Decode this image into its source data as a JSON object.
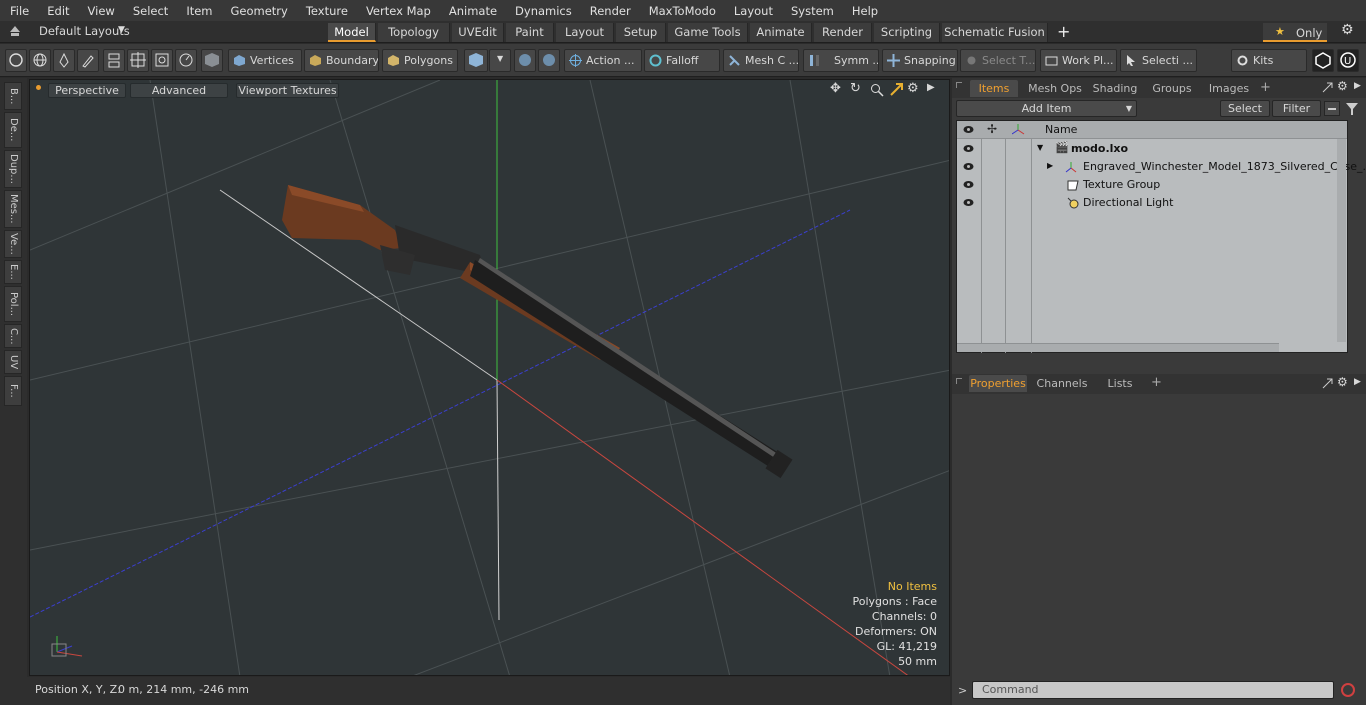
{
  "menu": [
    "File",
    "Edit",
    "View",
    "Select",
    "Item",
    "Geometry",
    "Texture",
    "Vertex Map",
    "Animate",
    "Dynamics",
    "Render",
    "MaxToModo",
    "Layout",
    "System",
    "Help"
  ],
  "layout_selector": "Default Layouts",
  "layout_tabs": [
    {
      "label": "Model",
      "active": true
    },
    {
      "label": "Topology"
    },
    {
      "label": "UVEdit"
    },
    {
      "label": "Paint"
    },
    {
      "label": "Layout"
    },
    {
      "label": "Setup"
    },
    {
      "label": "Game Tools"
    },
    {
      "label": "Animate"
    },
    {
      "label": "Render"
    },
    {
      "label": "Scripting"
    },
    {
      "label": "Schematic Fusion"
    }
  ],
  "only_label": "Only",
  "toolbar": {
    "vertices": "Vertices",
    "boundary": "Boundary",
    "polygons": "Polygons",
    "action": "Action ...",
    "falloff": "Falloff",
    "mesh_c": "Mesh C ...",
    "symm": "Symm ...",
    "snapping": "Snapping",
    "select_t": "Select T...",
    "work_pl": "Work Pl...",
    "selecti": "Selecti ...",
    "kits": "Kits"
  },
  "left_tabs": [
    "B...",
    "De...",
    "Dup...",
    "Mes...",
    "Ve...",
    "E...",
    "Pol...",
    "C...",
    "UV",
    "F..."
  ],
  "viewport": {
    "perspective": "Perspective",
    "advanced": "Advanced",
    "textures": "Viewport Textures",
    "hud": {
      "no_items": "No Items",
      "polygons": "Polygons : Face",
      "channels": "Channels: 0",
      "deformers": "Deformers: ON",
      "gl": "GL: 41,219",
      "scale": "50 mm"
    },
    "axis_colors": {
      "x": "#c8473f",
      "y": "#3fbf3f",
      "z": "#3b3fcf"
    }
  },
  "status": {
    "label": "Position X, Y, Z:",
    "value": "0 m, 214 mm, -246 mm"
  },
  "items_panel": {
    "tabs": [
      {
        "label": "Items",
        "active": true
      },
      {
        "label": "Mesh Ops"
      },
      {
        "label": "Shading"
      },
      {
        "label": "Groups"
      },
      {
        "label": "Images"
      }
    ],
    "add_item": "Add Item",
    "select": "Select",
    "filter": "Filter",
    "col_name": "Name",
    "rows": [
      {
        "label": "modo.lxo"
      },
      {
        "label": "Engraved_Winchester_Model_1873_Silvered_Case_..."
      },
      {
        "label": "Texture Group"
      },
      {
        "label": "Directional Light"
      }
    ]
  },
  "props_panel": {
    "tabs": [
      {
        "label": "Properties",
        "active": true
      },
      {
        "label": "Channels"
      },
      {
        "label": "Lists"
      }
    ]
  },
  "command": {
    "placeholder": "Command"
  }
}
